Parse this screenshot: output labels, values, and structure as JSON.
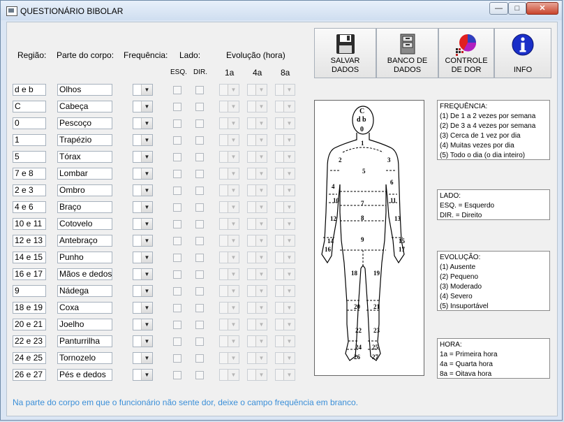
{
  "window": {
    "title": "QUESTIONÁRIO BIBOLAR"
  },
  "headers": {
    "regiao": "Região:",
    "parte": "Parte do corpo:",
    "frequencia": "Frequência:",
    "lado": "Lado:",
    "esq": "ESQ.",
    "dir": "DIR.",
    "evolucao": "Evolução (hora)",
    "h1": "1a",
    "h4": "4a",
    "h8": "8a"
  },
  "rows": [
    {
      "regiao": "d e b",
      "parte": "Olhos"
    },
    {
      "regiao": "C",
      "parte": "Cabeça"
    },
    {
      "regiao": "0",
      "parte": "Pescoço"
    },
    {
      "regiao": "1",
      "parte": "Trapézio"
    },
    {
      "regiao": "5",
      "parte": "Tórax"
    },
    {
      "regiao": "7 e 8",
      "parte": "Lombar"
    },
    {
      "regiao": "2 e 3",
      "parte": "Ombro"
    },
    {
      "regiao": "4 e 6",
      "parte": "Braço"
    },
    {
      "regiao": "10 e 11",
      "parte": "Cotovelo"
    },
    {
      "regiao": "12 e 13",
      "parte": "Antebraço"
    },
    {
      "regiao": "14 e 15",
      "parte": "Punho"
    },
    {
      "regiao": "16 e 17",
      "parte": "Mãos e dedos"
    },
    {
      "regiao": "9",
      "parte": "Nádega"
    },
    {
      "regiao": "18 e 19",
      "parte": "Coxa"
    },
    {
      "regiao": "20 e 21",
      "parte": "Joelho"
    },
    {
      "regiao": "22 e 23",
      "parte": "Panturrilha"
    },
    {
      "regiao": "24 e 25",
      "parte": "Tornozelo"
    },
    {
      "regiao": "26 e 27",
      "parte": "Pés e dedos"
    }
  ],
  "toolbar": {
    "salvar": [
      "SALVAR",
      "DADOS"
    ],
    "banco": [
      "BANCO DE",
      "DADOS"
    ],
    "controle": [
      "CONTROLE",
      "DE DOR"
    ],
    "info": [
      "INFO"
    ]
  },
  "body_labels": {
    "head": [
      "C",
      "d b",
      "0"
    ],
    "nums": [
      "1",
      "2",
      "3",
      "4",
      "5",
      "6",
      "7",
      "8",
      "9",
      "10",
      "11",
      "12",
      "13",
      "14",
      "15",
      "16",
      "17",
      "18",
      "19",
      "20",
      "21",
      "22",
      "23",
      "24",
      "25",
      "26",
      "27"
    ]
  },
  "legends": {
    "frequencia": {
      "title": "FREQUÊNCIA:",
      "lines": [
        "(1) De 1 a 2 vezes por semana",
        "(2) De 3 a 4 vezes por semana",
        "(3) Cerca de 1 vez por dia",
        "(4) Muitas vezes por dia",
        "(5) Todo o dia (o dia inteiro)"
      ]
    },
    "lado": {
      "title": "LADO:",
      "lines": [
        "ESQ. = Esquerdo",
        "DIR. = Direito"
      ]
    },
    "evolucao": {
      "title": "EVOLUÇÃO:",
      "lines": [
        "(1) Ausente",
        "(2) Pequeno",
        "(3) Moderado",
        "(4) Severo",
        "(5) Insuportável"
      ]
    },
    "hora": {
      "title": "HORA:",
      "lines": [
        "1a = Primeira hora",
        "4a = Quarta hora",
        "8a = Oitava hora"
      ]
    }
  },
  "note": "Na parte do corpo em que o funcionário não sente dor, deixe o campo frequência em branco."
}
